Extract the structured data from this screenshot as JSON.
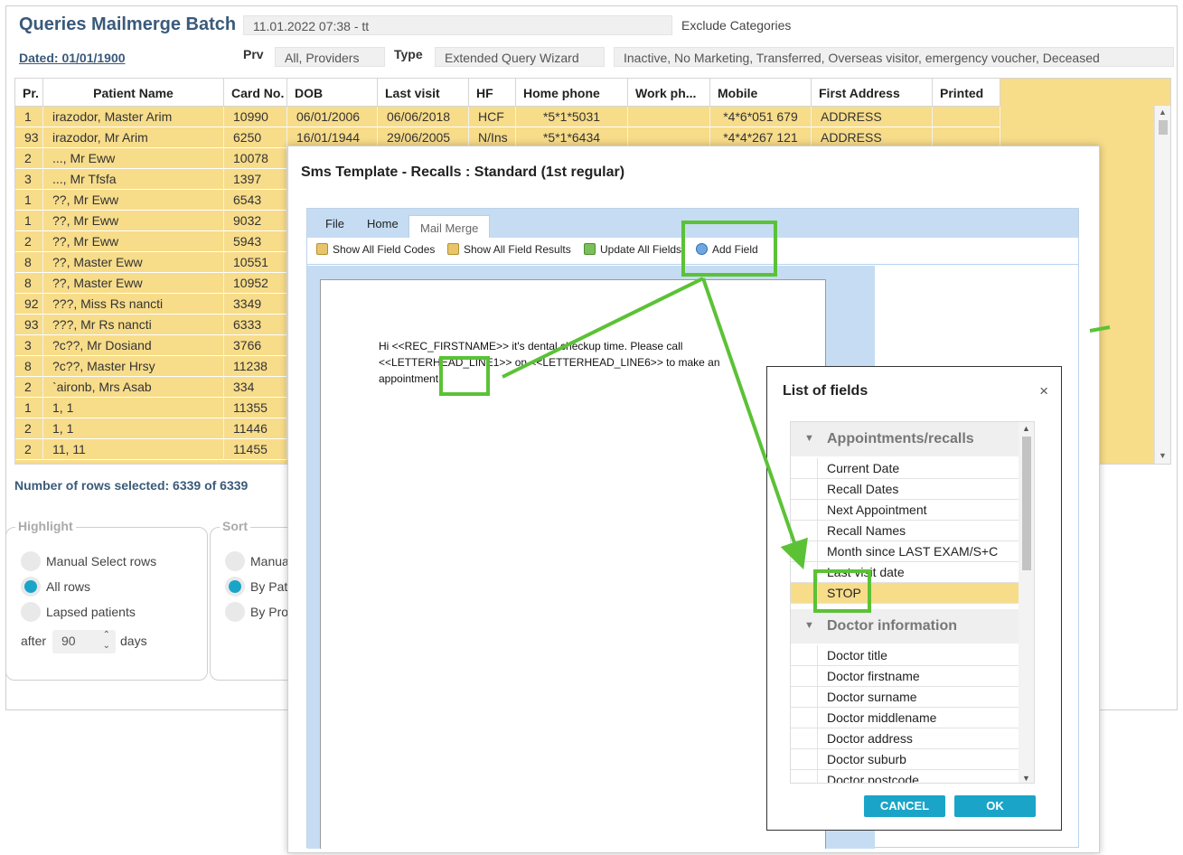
{
  "header": {
    "title": "Queries Mailmerge Batch",
    "dated": "Dated: 01/01/1900",
    "batch_name": "11.01.2022 07:38 - tt",
    "exclude_categories_label": "Exclude Categories",
    "prv_label": "Prv",
    "prv_value": "All, Providers",
    "type_label": "Type",
    "type_value": "Extended Query Wizard",
    "exclude_value": "Inactive, No Marketing, Transferred, Overseas visitor, emergency voucher, Deceased"
  },
  "grid": {
    "columns": [
      "Pr.",
      "Patient Name",
      "Card No.",
      "DOB",
      "Last visit",
      "HF",
      "Home phone",
      "Work ph...",
      "Mobile",
      "First Address",
      "Printed"
    ],
    "rows": [
      {
        "pr": "1",
        "name": "irazodor, Master Arim",
        "card": "10990",
        "dob": "06/01/2006",
        "last": "06/06/2018",
        "hf": "HCF",
        "home": "*5*1*5031",
        "work": "",
        "mobile": "*4*6*051 679",
        "addr": "ADDRESS",
        "printed": ""
      },
      {
        "pr": "93",
        "name": "irazodor, Mr Arim",
        "card": "6250",
        "dob": "16/01/1944",
        "last": "29/06/2005",
        "hf": "N/Ins",
        "home": "*5*1*6434",
        "work": "",
        "mobile": "*4*4*267 121",
        "addr": "ADDRESS",
        "printed": ""
      },
      {
        "pr": "2",
        "name": "..., Mr Eww",
        "card": "10078"
      },
      {
        "pr": "3",
        "name": "..., Mr Tfsfa",
        "card": "1397"
      },
      {
        "pr": "1",
        "name": "??, Mr Eww",
        "card": "6543"
      },
      {
        "pr": "1",
        "name": "??, Mr Eww",
        "card": "9032"
      },
      {
        "pr": "2",
        "name": "??, Mr Eww",
        "card": "5943"
      },
      {
        "pr": "8",
        "name": "??, Master Eww",
        "card": "10551"
      },
      {
        "pr": "8",
        "name": "??, Master Eww",
        "card": "10952"
      },
      {
        "pr": "92",
        "name": "???, Miss Rs nancti",
        "card": "3349"
      },
      {
        "pr": "93",
        "name": "???, Mr Rs nancti",
        "card": "6333"
      },
      {
        "pr": "3",
        "name": "?c??, Mr Dosiand",
        "card": "3766"
      },
      {
        "pr": "8",
        "name": "?c??, Master Hrsy",
        "card": "11238"
      },
      {
        "pr": "2",
        "name": "`aironb, Mrs Asab",
        "card": "334"
      },
      {
        "pr": "1",
        "name": "1, 1",
        "card": "11355"
      },
      {
        "pr": "2",
        "name": "1, 1",
        "card": "11446"
      },
      {
        "pr": "2",
        "name": "11, 11",
        "card": "11455"
      }
    ]
  },
  "status": {
    "rows_selected": "Number of rows selected: 6339 of 6339"
  },
  "highlight": {
    "legend": "Highlight",
    "options": [
      "Manual Select rows",
      "All rows",
      "Lapsed patients"
    ],
    "selected": "All rows",
    "after_label": "after",
    "days_value": "90",
    "days_label": "days"
  },
  "sort": {
    "legend": "Sort",
    "options": [
      "Manua",
      "By Pat",
      "By Pro"
    ],
    "selected": "By Pat"
  },
  "sms_dialog": {
    "title": "Sms Template - Recalls : Standard (1st regular)",
    "tabs": [
      "File",
      "Home",
      "Mail Merge"
    ],
    "active_tab": "Mail Merge",
    "toolbar": [
      "Show All Field Codes",
      "Show All Field Results",
      "Update All Fields",
      "Add Field"
    ],
    "doc_lines": [
      "Hi <<REC_FIRSTNAME>> it's dental checkup time. Please call",
      "<<LETTERHEAD_LINE1>> on <<LETTERHEAD_LINE6>> to make an",
      "appointment."
    ]
  },
  "fields_dialog": {
    "title": "List of fields",
    "close": "×",
    "groups": [
      {
        "label": "Appointments/recalls",
        "items": [
          "Current Date",
          "Recall Dates",
          "Next Appointment",
          "Recall Names",
          "Month since LAST EXAM/S+C",
          "Last visit date",
          "STOP"
        ]
      },
      {
        "label": "Doctor information",
        "items": [
          "Doctor title",
          "Doctor firstname",
          "Doctor surname",
          "Doctor middlename",
          "Doctor address",
          "Doctor suburb",
          "Doctor postcode"
        ]
      }
    ],
    "selected_item": "STOP",
    "cancel_label": "CANCEL",
    "ok_label": "OK"
  },
  "colors": {
    "row_highlight": "#f7dc8a",
    "accent": "#1aa5c8",
    "title_blue": "#3a5a7a",
    "annotation_green": "#5bc236"
  },
  "icons": {
    "group_toggle": "▼",
    "scroll_up": "▲",
    "scroll_down": "▼",
    "spin": "⌃⌄"
  }
}
